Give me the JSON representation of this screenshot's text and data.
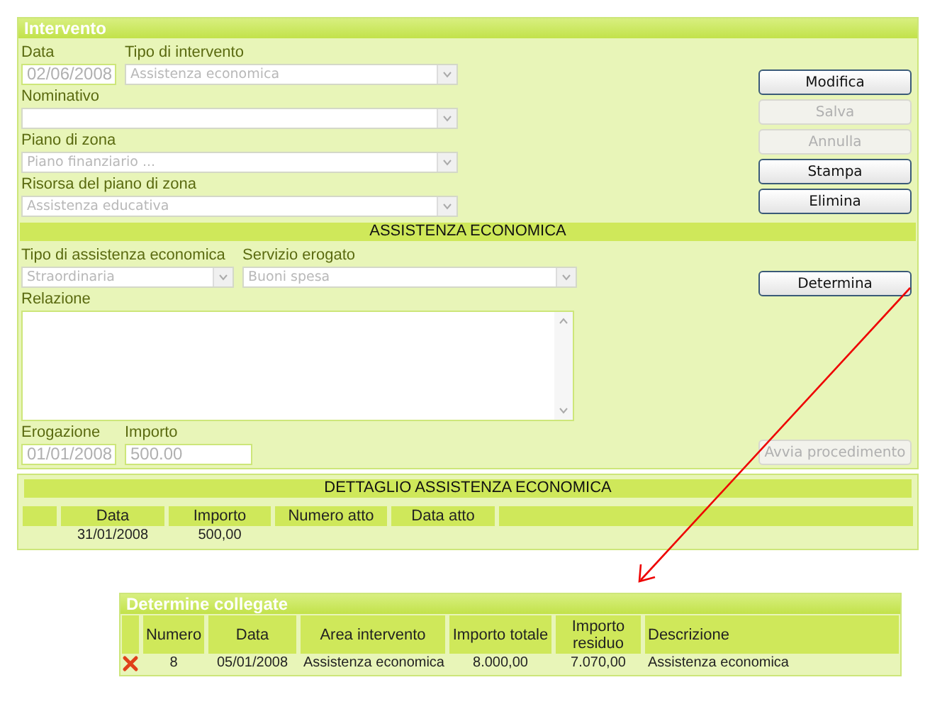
{
  "intervento": {
    "title": "Intervento",
    "date": {
      "label": "Data",
      "value": "02/06/2008",
      "disabled": true
    },
    "selects": [
      {
        "label": "Tipo di intervento",
        "value": "Assistenza economica",
        "disabled": true
      },
      {
        "label": "Nominativo",
        "disabled": true
      },
      {
        "label": "Piano di zona",
        "value": "Piano finanziario ...",
        "disabled": true
      },
      {
        "label": "Risorsa del piano di zona",
        "value": "Assistenza educativa",
        "disabled": true
      }
    ],
    "buttons": [
      {
        "label": "Modifica",
        "disabled": false
      },
      {
        "label": "Salva",
        "disabled": true
      },
      {
        "label": "Annulla",
        "disabled": true
      },
      {
        "label": "Stampa",
        "disabled": false
      },
      {
        "label": "Elimina",
        "disabled": false
      }
    ]
  },
  "assistenza": {
    "title": "ASSISTENZA ECONOMICA",
    "tipo": {
      "label": "Tipo di assistenza economica",
      "value": "Straordinaria",
      "disabled": true
    },
    "servizio": {
      "label": "Servizio erogato",
      "value": "Buoni spesa",
      "disabled": true
    },
    "relazione": {
      "label": "Relazione"
    },
    "erogazione": {
      "label": "Erogazione",
      "value": "01/01/2008",
      "disabled": true
    },
    "importo": {
      "label": "Importo",
      "value": "500.00",
      "disabled": true
    },
    "determina_button": {
      "label": "Determina",
      "disabled": false
    },
    "avvia_button": {
      "label": "Avvia procedimento",
      "disabled": true
    }
  },
  "dettaglio": {
    "title": "DETTAGLIO ASSISTENZA ECONOMICA",
    "columns": [
      "Data",
      "Importo",
      "Numero atto",
      "Data atto"
    ],
    "rows": [
      {
        "data": "31/01/2008",
        "importo": "500,00"
      }
    ]
  },
  "determine": {
    "title": "Determine collegate",
    "columns": [
      "Numero",
      "Data",
      "Area intervento",
      "Importo totale",
      "Importo residuo",
      "Descrizione"
    ],
    "rows": [
      {
        "cells": [
          "8",
          "05/01/2008",
          "Assistenza economica",
          "8.000,00",
          "7.070,00",
          "Assistenza economica"
        ]
      }
    ]
  }
}
